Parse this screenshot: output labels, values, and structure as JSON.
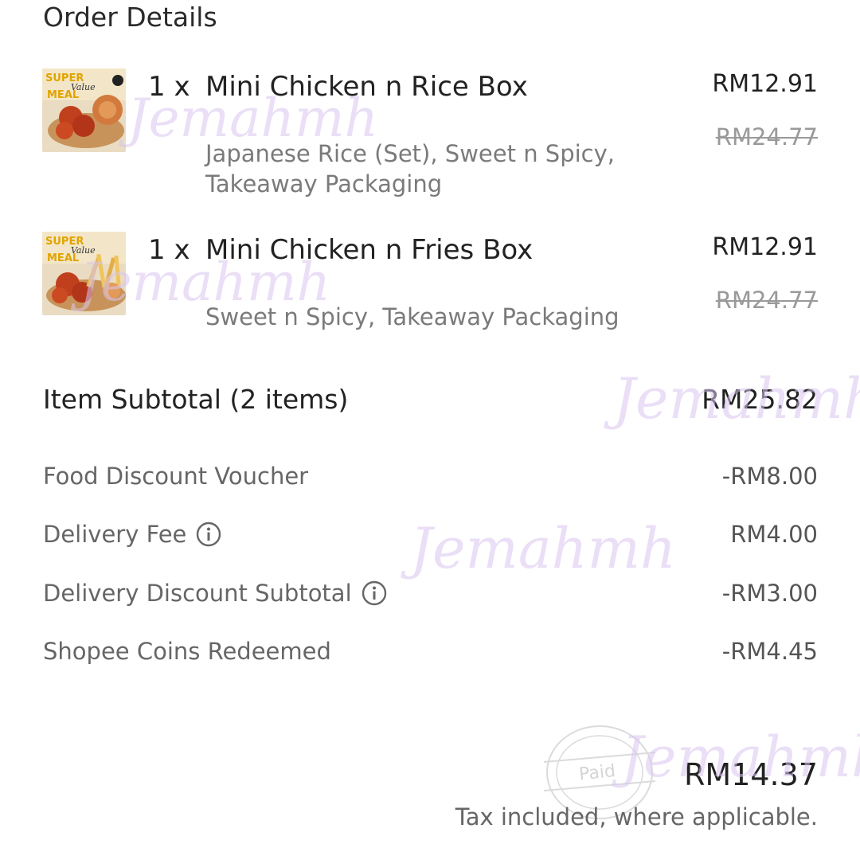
{
  "section_title": "Order Details",
  "items": [
    {
      "qty": "1 x",
      "name": "Mini Chicken n Rice Box",
      "price": "RM12.91",
      "original_price": "RM24.77",
      "options": "Japanese Rice (Set), Sweet n Spicy, Takeaway Packaging",
      "thumb_text": "Super Value Meal"
    },
    {
      "qty": "1 x",
      "name": "Mini Chicken n Fries Box",
      "price": "RM12.91",
      "original_price": "RM24.77",
      "options": "Sweet n Spicy, Takeaway Packaging",
      "thumb_text": "Super Value Meal"
    }
  ],
  "subtotal": {
    "label": "Item Subtotal (2 items)",
    "value": "RM25.82"
  },
  "fees": [
    {
      "label": "Food Discount Voucher",
      "value": "-RM8.00",
      "info_icon": false
    },
    {
      "label": "Delivery Fee",
      "value": "RM4.00",
      "info_icon": true
    },
    {
      "label": "Delivery Discount Subtotal",
      "value": "-RM3.00",
      "info_icon": true
    },
    {
      "label": "Shopee Coins Redeemed",
      "value": "-RM4.45",
      "info_icon": false
    }
  ],
  "total": "RM14.37",
  "tax_note": "Tax included, where applicable.",
  "stamp_text": "Paid",
  "watermark_text": "Jemahmh",
  "icons": {
    "info": "info-circle-icon"
  },
  "colors": {
    "text_primary": "#222222",
    "text_secondary": "#7a7a7a",
    "strike": "#9a9a9a",
    "watermark": "#d9c6ef"
  }
}
